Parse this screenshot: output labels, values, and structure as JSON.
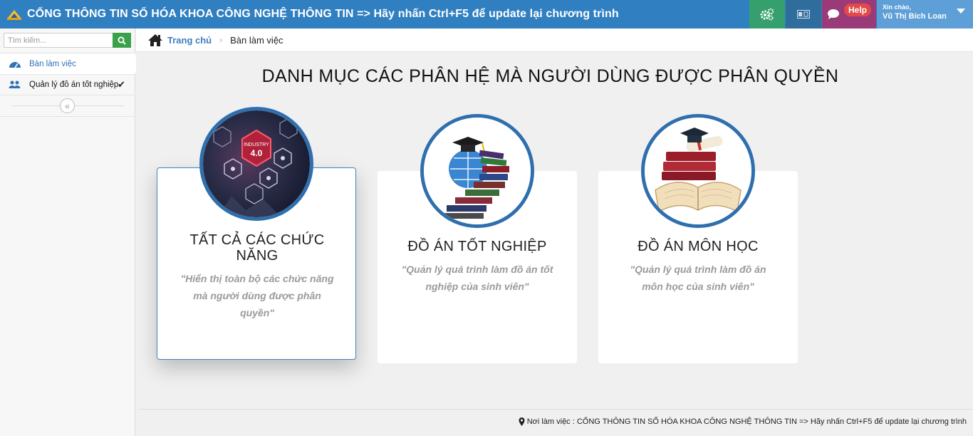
{
  "header": {
    "title": "CỔNG THÔNG TIN SỐ HÓA KHOA CÔNG NGHỆ THÔNG TIN => Hãy nhấn Ctrl+F5 để update lại chương trình",
    "help_label": "Help",
    "greeting": "Xin chào,",
    "user_name": "Vũ Thị Bích Loan",
    "colors": {
      "bar": "#307fc1",
      "settings": "#35a06e",
      "lang": "#2f6d9d",
      "chat": "#9a3a79",
      "user": "#5d9fd6"
    },
    "icons": [
      "brand-logo-icon",
      "settings-gears-icon",
      "language-icon",
      "chat-bubble-icon",
      "caret-down-icon"
    ]
  },
  "sidebar": {
    "search_placeholder": "Tìm kiếm...",
    "items": [
      {
        "label": "Bàn làm việc",
        "icon": "dashboard-icon",
        "active": true
      },
      {
        "label": "Quản lý đồ án tốt nghiệp",
        "icon": "users-icon",
        "active": false
      }
    ],
    "collapse_icon": "double-chevron-left-icon"
  },
  "breadcrumb": {
    "home": "Trang chủ",
    "current": "Bàn làm việc"
  },
  "main": {
    "title": "DANH MỤC CÁC PHÂN HỆ MÀ NGƯỜI DÙNG ĐƯỢC PHÂN QUYỀN",
    "cards": [
      {
        "title": "TẤT CẢ CÁC CHỨC NĂNG",
        "description": "\"Hiển thị toàn bộ các chức năng mà người dùng được phân quyền\"",
        "image": "industry-4-image",
        "selected": true
      },
      {
        "title": "ĐỒ ÁN TỐT NGHIỆP",
        "description": "\"Quản lý quá trình làm đồ án tốt nghiệp của sinh viên\"",
        "image": "graduation-books-image",
        "selected": false
      },
      {
        "title": "ĐỒ ÁN MÔN HỌC",
        "description": "\"Quản lý quá trình làm đồ án môn học của sinh viên\"",
        "image": "open-book-image",
        "selected": false
      }
    ]
  },
  "footer": {
    "text": "Nơi làm việc : CỔNG THÔNG TIN SỐ HÓA KHOA CÔNG NGHỆ THÔNG TIN => Hãy nhấn Ctrl+F5 để update lại chương trình"
  }
}
